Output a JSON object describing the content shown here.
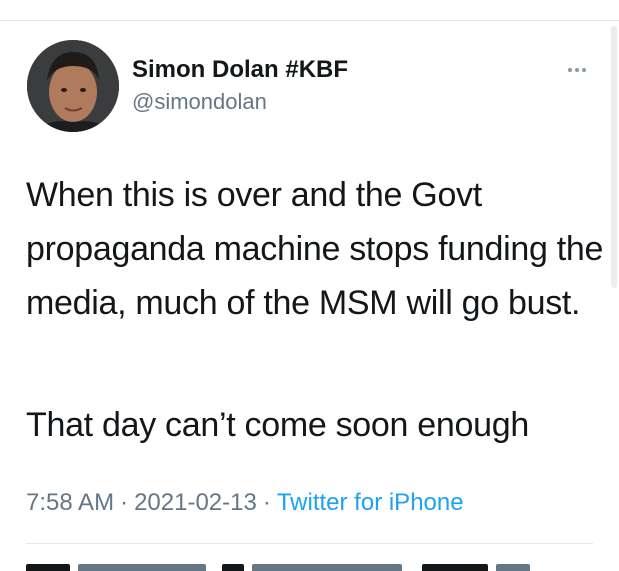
{
  "tweet": {
    "author": {
      "display_name": "Simon Dolan #KBF",
      "handle": "@simondolan",
      "avatar": "profile-photo"
    },
    "paragraphs": [
      "When this is over and the Govt propaganda machine stops funding the media, much of the MSM will go bust.",
      "That day can’t come soon enough"
    ],
    "time": "7:58 AM",
    "separator": "·",
    "date": "2021-02-13",
    "source": "Twitter for iPhone"
  },
  "icons": {
    "more": "more-horizontal-icon"
  },
  "colors": {
    "text": "#14171a",
    "secondary": "#657786",
    "link": "#1da1f2",
    "divider": "#e1e8ed"
  }
}
